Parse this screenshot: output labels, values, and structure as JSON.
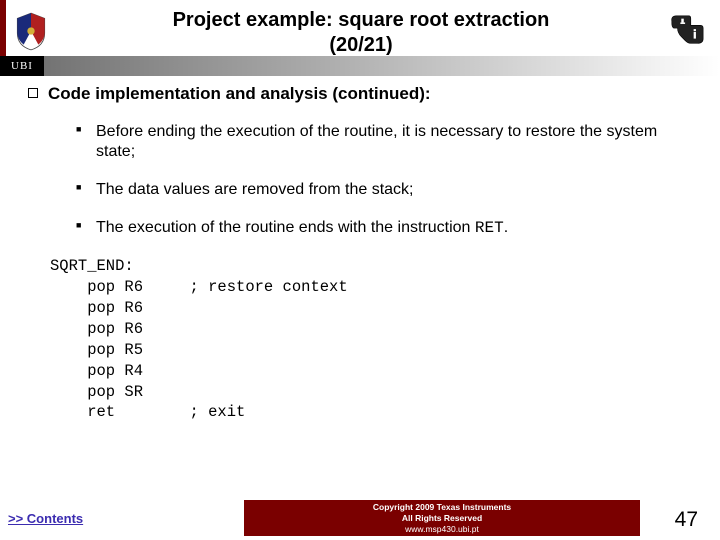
{
  "header": {
    "title_line1": "Project example: square root extraction",
    "title_line2": "(20/21)",
    "ubi_label": "UBI"
  },
  "content": {
    "heading": "Code implementation and analysis (continued):",
    "bullets": [
      "Before ending the execution of the routine, it is necessary to restore the system state;",
      "The data values are removed from the stack;",
      "The execution of the routine ends with the instruction"
    ],
    "bullet3_mono": "RET",
    "bullet3_tail": "."
  },
  "code": "SQRT_END:\n    pop R6     ; restore context\n    pop R6\n    pop R6\n    pop R5\n    pop R4\n    pop SR\n    ret        ; exit",
  "footer": {
    "contents_link": ">> Contents",
    "copyright": "Copyright  2009 Texas Instruments",
    "rights": "All Rights Reserved",
    "url": "www.msp430.ubi.pt",
    "page_num": "47"
  }
}
